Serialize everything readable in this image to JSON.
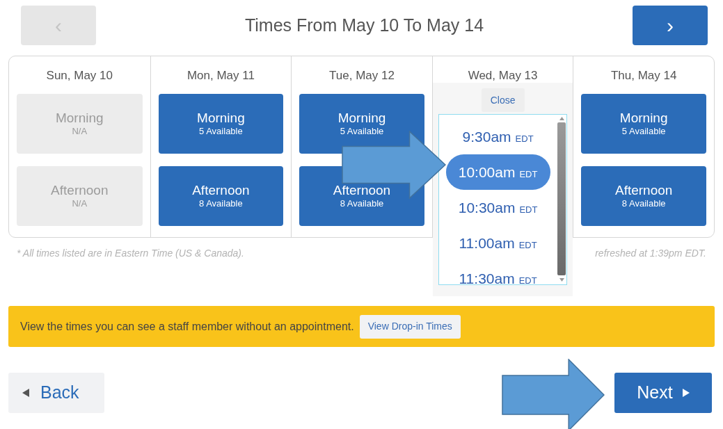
{
  "nav": {
    "prev": {
      "label": "‹",
      "disabled": true
    },
    "title": "Times From May 10 To May 14",
    "next": {
      "label": "›",
      "disabled": false
    }
  },
  "days": [
    {
      "label": "Sun, May 10",
      "kind": "slots",
      "slots": [
        {
          "name": "Morning",
          "availability": "N/A",
          "disabled": true
        },
        {
          "name": "Afternoon",
          "availability": "N/A",
          "disabled": true
        }
      ]
    },
    {
      "label": "Mon, May 11",
      "kind": "slots",
      "slots": [
        {
          "name": "Morning",
          "availability": "5 Available",
          "disabled": false
        },
        {
          "name": "Afternoon",
          "availability": "8 Available",
          "disabled": false
        }
      ]
    },
    {
      "label": "Tue, May 12",
      "kind": "slots",
      "slots": [
        {
          "name": "Morning",
          "availability": "5 Available",
          "disabled": false
        },
        {
          "name": "Afternoon",
          "availability": "8 Available",
          "disabled": false
        }
      ]
    },
    {
      "label": "Wed, May 13",
      "kind": "times",
      "close": "Close",
      "times": [
        {
          "time": "9:30am",
          "zone": "EDT",
          "selected": false
        },
        {
          "time": "10:00am",
          "zone": "EDT",
          "selected": true
        },
        {
          "time": "10:30am",
          "zone": "EDT",
          "selected": false
        },
        {
          "time": "11:00am",
          "zone": "EDT",
          "selected": false
        },
        {
          "time": "11:30am",
          "zone": "EDT",
          "selected": false
        }
      ]
    },
    {
      "label": "Thu, May 14",
      "kind": "slots",
      "slots": [
        {
          "name": "Morning",
          "availability": "5 Available",
          "disabled": false
        },
        {
          "name": "Afternoon",
          "availability": "8 Available",
          "disabled": false
        }
      ]
    }
  ],
  "timezone_note": "* All times listed are in Eastern Time (US & Canada).",
  "refreshed": "refreshed at 1:39pm EDT.",
  "banner": {
    "text": "View the times you can see a staff member without an appointment.",
    "button": "View Drop-in Times"
  },
  "back": "Back",
  "next": "Next"
}
